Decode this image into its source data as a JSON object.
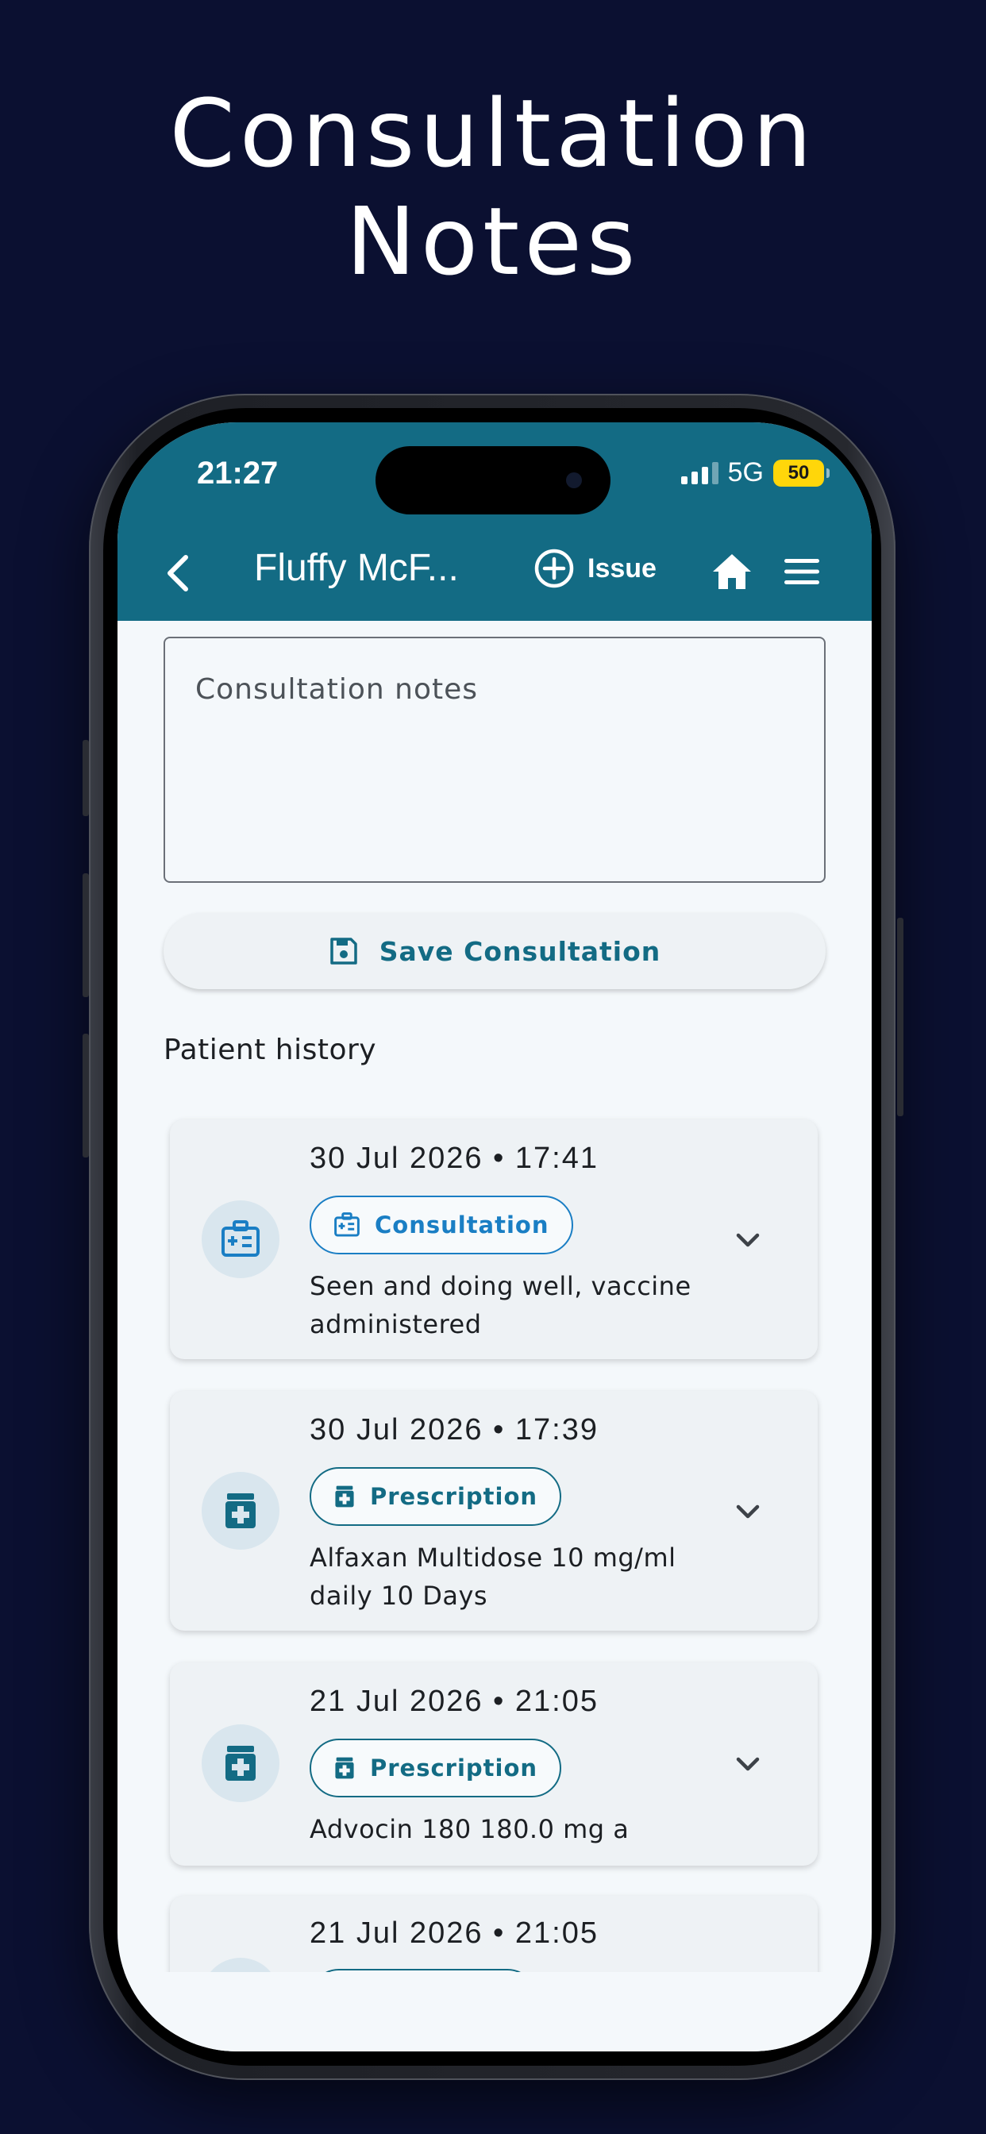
{
  "headline": {
    "line1": "Consultation",
    "line2": "Notes"
  },
  "status_bar": {
    "time": "21:27",
    "network": "5G",
    "battery": "50"
  },
  "app_bar": {
    "title": "Fluffy McF...",
    "issue_label": "Issue",
    "icons": [
      "chevron-left-icon",
      "plus-circle-icon",
      "home-icon",
      "menu-icon"
    ]
  },
  "notes": {
    "placeholder": "Consultation notes",
    "value": ""
  },
  "save_button": {
    "label": "Save Consultation",
    "icon": "save-icon"
  },
  "history": {
    "title": "Patient history",
    "items": [
      {
        "date": "30 Jul 2026 • 17:41",
        "type": "Consultation",
        "text": "Seen and doing well, vaccine administered",
        "icon": "consultation-icon"
      },
      {
        "date": "30 Jul 2026 • 17:39",
        "type": "Prescription",
        "text": "Alfaxan Multidose 10 mg/ml daily 10 Days",
        "icon": "prescription-icon"
      },
      {
        "date": "21 Jul 2026 • 21:05",
        "type": "Prescription",
        "text": "Advocin 180 180.0 mg a",
        "icon": "prescription-icon"
      },
      {
        "date": "21 Jul 2026 • 21:05",
        "type": "",
        "text": "",
        "icon": "prescription-icon"
      }
    ]
  },
  "colors": {
    "background": "#0b1031",
    "app_bar": "#136b84",
    "accent": "#136b84",
    "consultation_chip": "#1a7ec4",
    "battery": "#ffd60a"
  }
}
